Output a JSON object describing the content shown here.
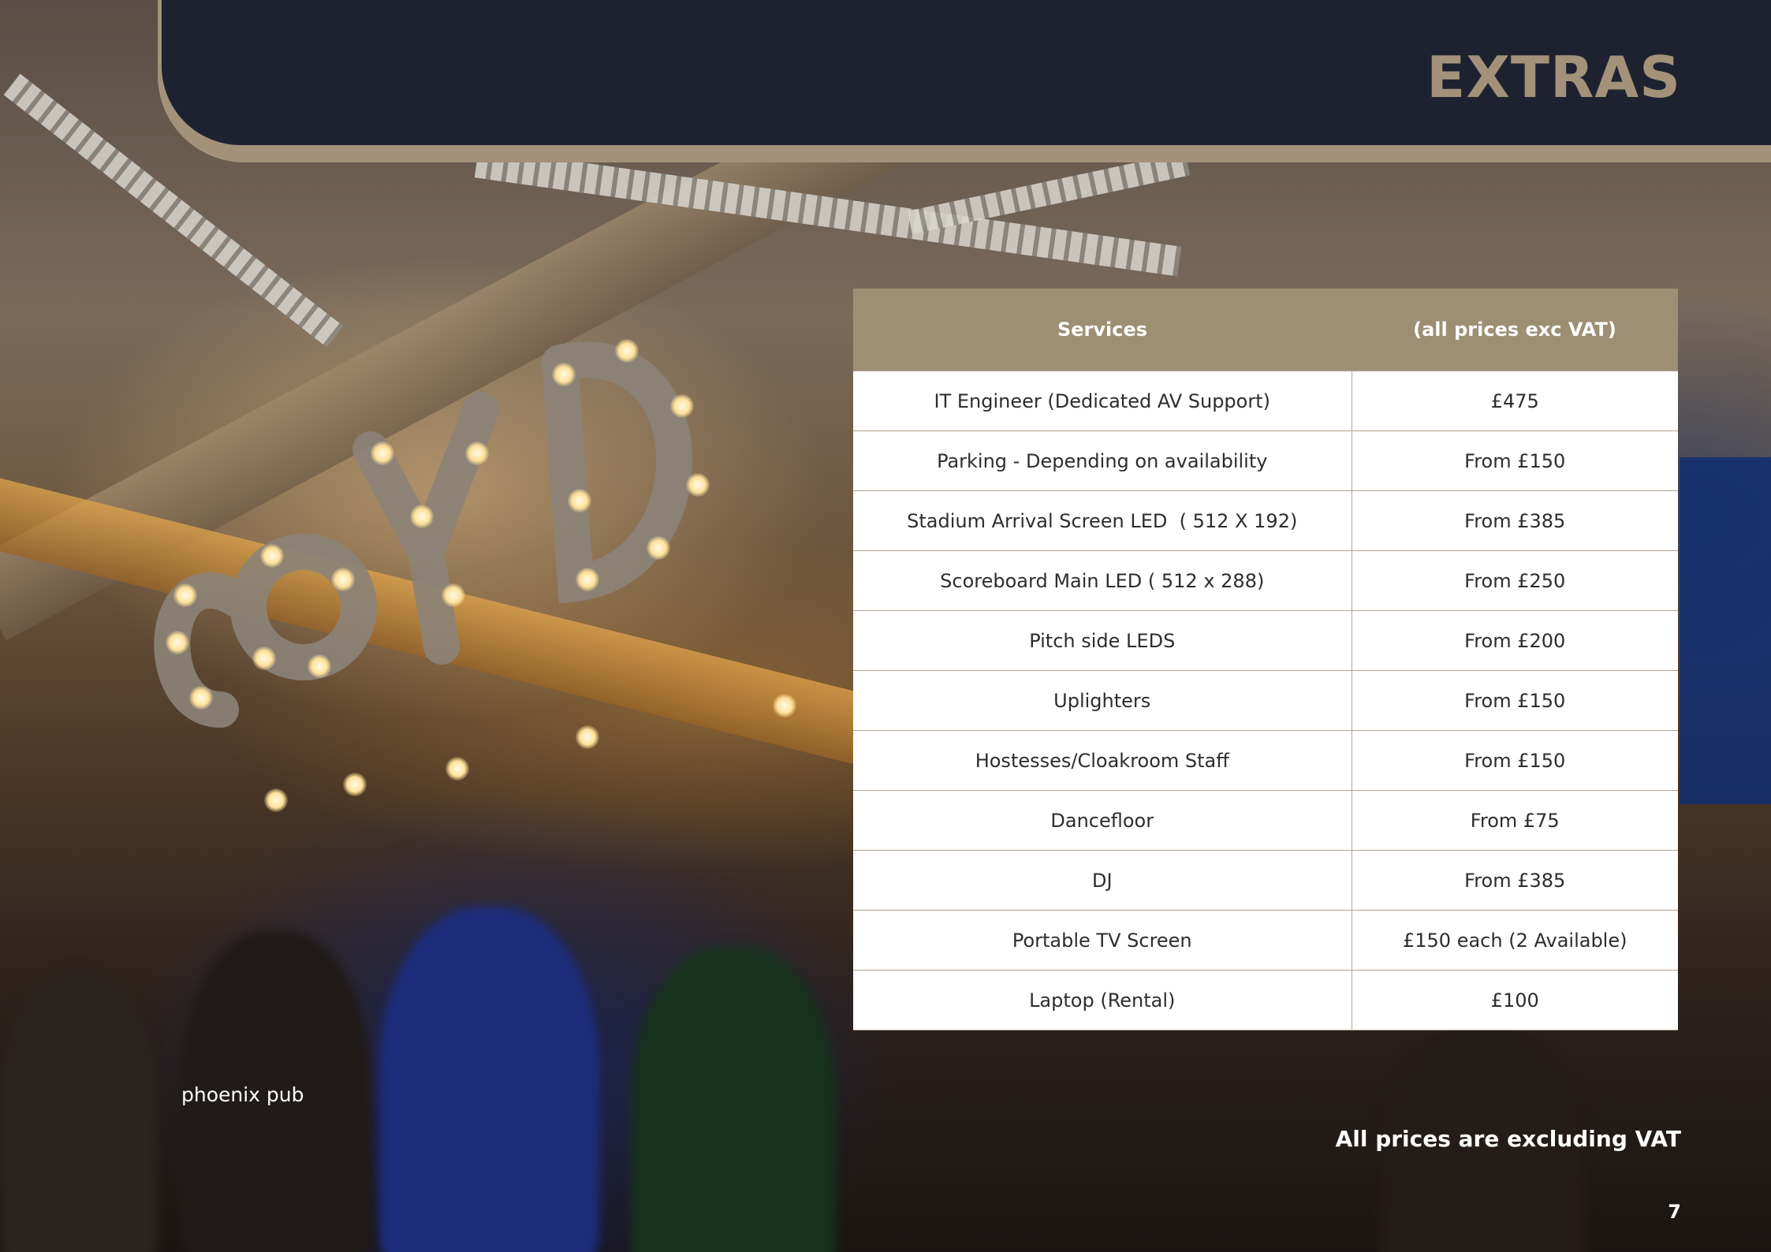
{
  "header": {
    "title": "EXTRAS"
  },
  "table": {
    "headers": [
      "Services",
      "(all prices exc VAT)"
    ],
    "rows": [
      [
        "IT Engineer (Dedicated AV Support)",
        "£475"
      ],
      [
        "Parking - Depending on availability",
        "From £150"
      ],
      [
        "Stadium Arrival Screen LED  ( 512 X 192)",
        "From £385"
      ],
      [
        "Scoreboard Main LED ( 512 x 288)",
        "From £250"
      ],
      [
        "Pitch side LEDS",
        "From £200"
      ],
      [
        "Uplighters",
        "From £150"
      ],
      [
        "Hostesses/Cloakroom Staff",
        "From £150"
      ],
      [
        "Dancefloor",
        "From £75"
      ],
      [
        "DJ",
        "From £385"
      ],
      [
        "Portable TV Screen",
        "£150 each (2 Available)"
      ],
      [
        "Laptop (Rental)",
        "£100"
      ]
    ]
  },
  "photo": {
    "caption": "phoenix pub",
    "sign_letters": [
      "C",
      "O",
      "Y",
      "D"
    ]
  },
  "footer": {
    "vat_note": "All prices are excluding VAT",
    "page_number": "7"
  },
  "colors": {
    "header_bg": "#1e2230",
    "accent_gold": "#a3917a",
    "table_header_bg": "#9e8e73",
    "table_border": "#b3a48c"
  }
}
